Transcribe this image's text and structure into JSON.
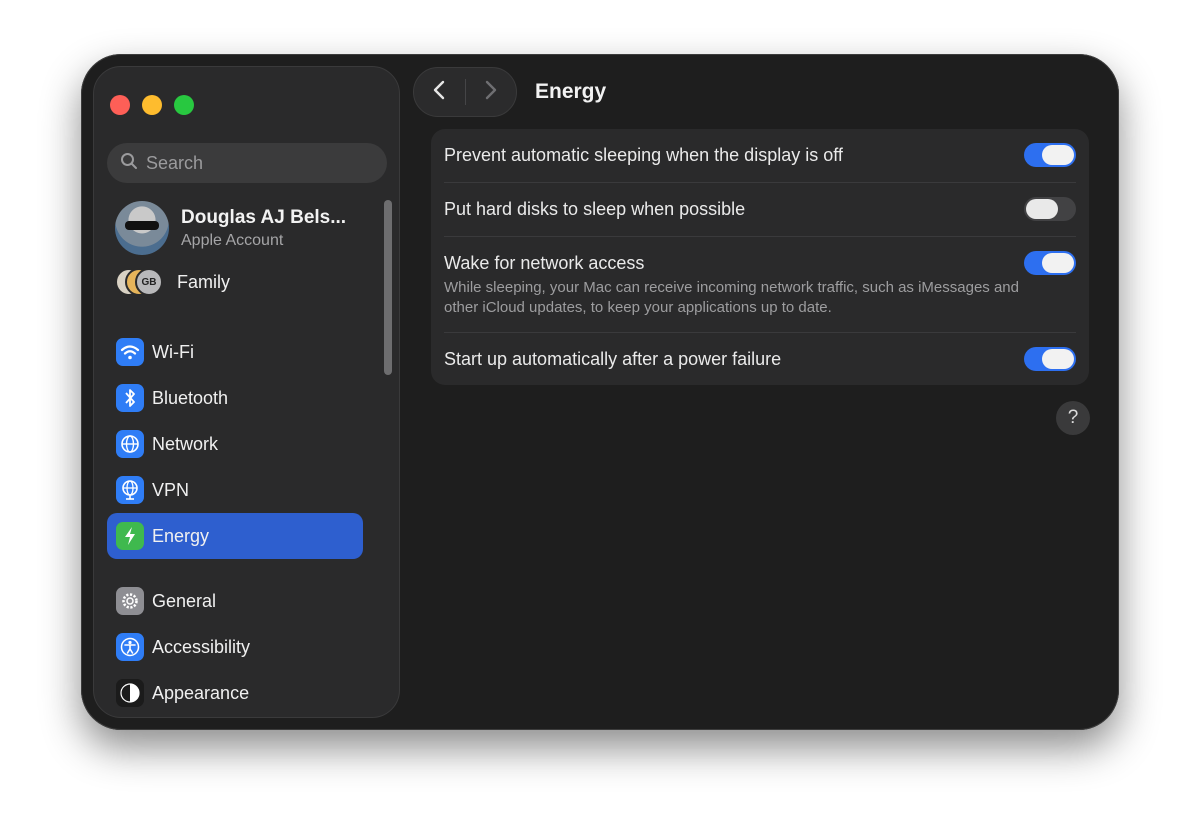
{
  "window": {
    "title": "Energy"
  },
  "search": {
    "placeholder": "Search"
  },
  "account": {
    "name": "Douglas AJ Bels...",
    "subtitle": "Apple Account"
  },
  "family": {
    "label": "Family",
    "avatar_initials": [
      "",
      "",
      "GB"
    ]
  },
  "sidebar": {
    "items": [
      {
        "label": "Wi-Fi",
        "icon": "wifi-icon",
        "color": "#2f7df6",
        "selected": false
      },
      {
        "label": "Bluetooth",
        "icon": "bluetooth-icon",
        "color": "#2f7df6",
        "selected": false
      },
      {
        "label": "Network",
        "icon": "globe-icon",
        "color": "#2f7df6",
        "selected": false
      },
      {
        "label": "VPN",
        "icon": "vpn-globe-icon",
        "color": "#2f7df6",
        "selected": false
      },
      {
        "label": "Energy",
        "icon": "lightning-icon",
        "color": "#3fb94e",
        "selected": true
      },
      {
        "label": "General",
        "icon": "gear-icon",
        "color": "#8e8e93",
        "selected": false
      },
      {
        "label": "Accessibility",
        "icon": "accessibility-icon",
        "color": "#2f7df6",
        "selected": false
      },
      {
        "label": "Appearance",
        "icon": "appearance-icon",
        "color": "#1b1b1b",
        "selected": false
      }
    ]
  },
  "settings": {
    "rows": [
      {
        "label": "Prevent automatic sleeping when the display is off",
        "description": "",
        "enabled": true
      },
      {
        "label": "Put hard disks to sleep when possible",
        "description": "",
        "enabled": false
      },
      {
        "label": "Wake for network access",
        "description": "While sleeping, your Mac can receive incoming network traffic, such as iMessages and other iCloud updates, to keep your applications up to date.",
        "enabled": true
      },
      {
        "label": "Start up automatically after a power failure",
        "description": "",
        "enabled": true
      }
    ]
  },
  "help": {
    "label": "?"
  },
  "colors": {
    "accent": "#2d6ff0",
    "selection": "#2e5fcf",
    "window_bg": "#1e1e1e",
    "sidebar_bg": "#2a2a2b"
  }
}
